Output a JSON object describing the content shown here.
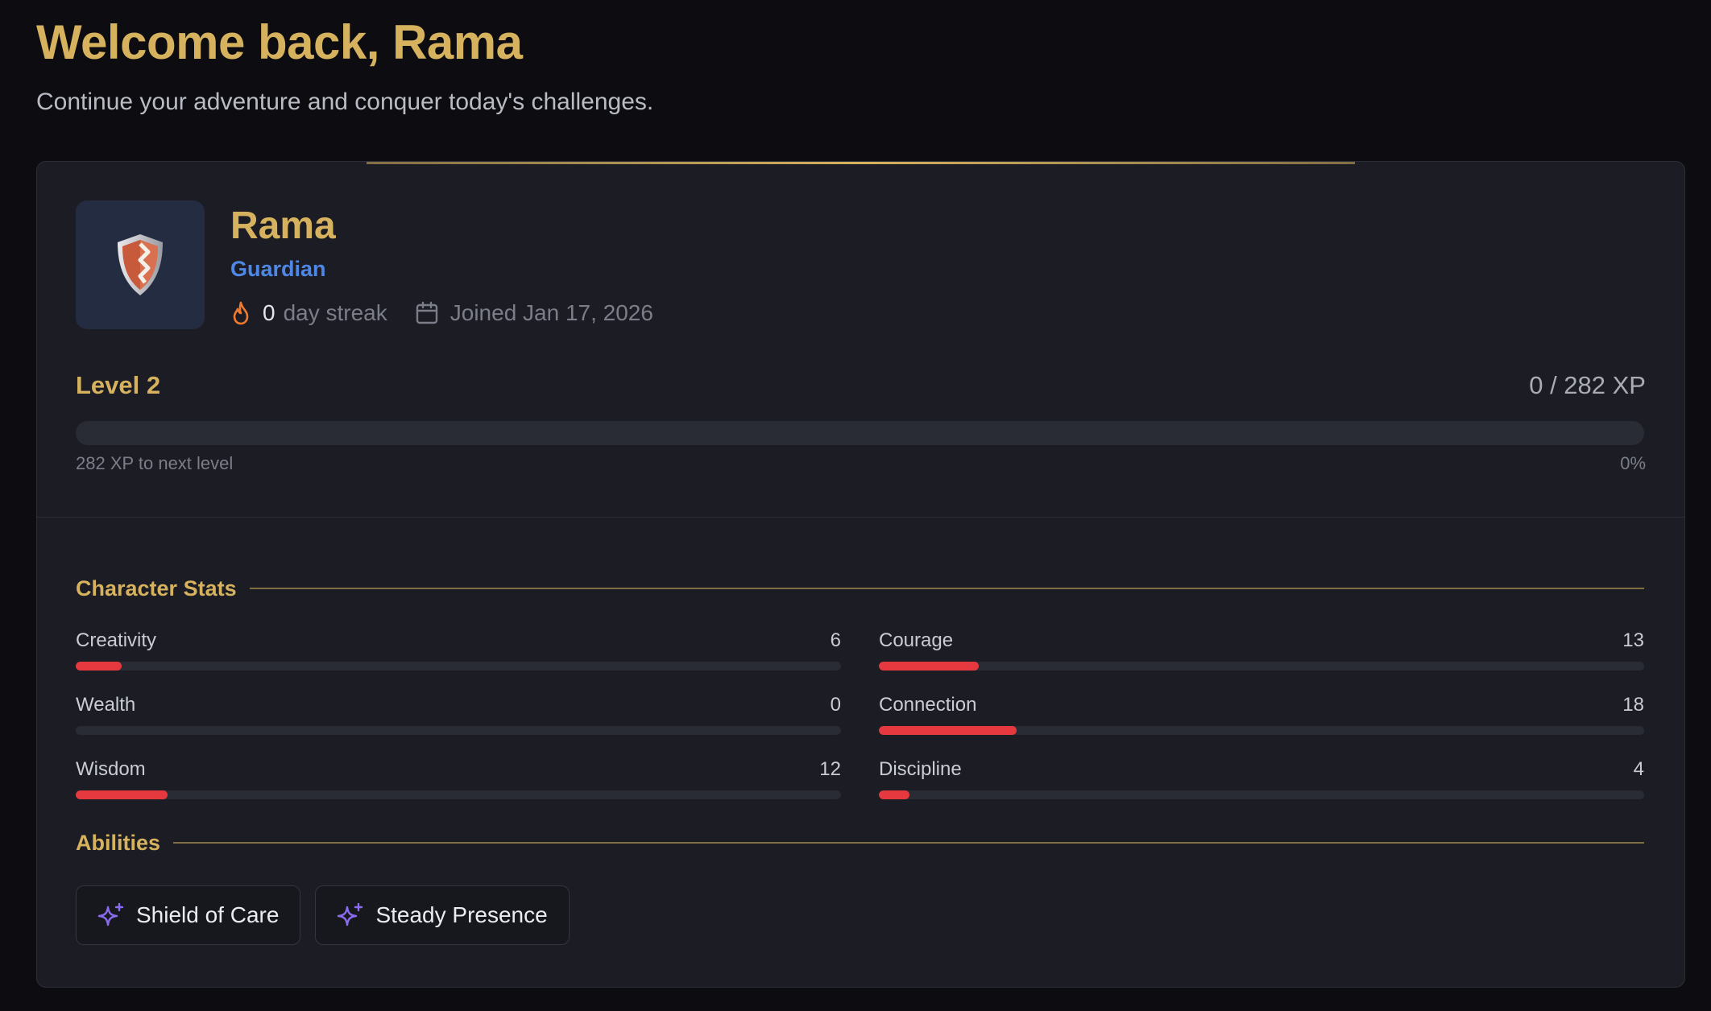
{
  "header": {
    "title": "Welcome back, Rama",
    "subtitle": "Continue your adventure and conquer today's challenges."
  },
  "profile": {
    "avatar_icon": "shield-icon",
    "name": "Rama",
    "class": "Guardian",
    "streak_count": "0",
    "streak_label": "day streak",
    "joined": "Joined Jan 17, 2026"
  },
  "level": {
    "label": "Level 2",
    "xp_total": "0 / 282 XP",
    "xp_progress_percent": 0,
    "next_label": "282 XP to next level",
    "percent_label": "0%"
  },
  "stats": {
    "heading": "Character Stats",
    "max_value": 100,
    "items": [
      {
        "name": "Creativity",
        "value": 6
      },
      {
        "name": "Courage",
        "value": 13
      },
      {
        "name": "Wealth",
        "value": 0
      },
      {
        "name": "Connection",
        "value": 18
      },
      {
        "name": "Wisdom",
        "value": 12
      },
      {
        "name": "Discipline",
        "value": 4
      }
    ]
  },
  "abilities": {
    "heading": "Abilities",
    "items": [
      {
        "label": "Shield of Care",
        "icon": "sparkles-icon"
      },
      {
        "label": "Steady Presence",
        "icon": "sparkles-icon"
      }
    ]
  },
  "colors": {
    "gold": "#d6b25e",
    "class_blue": "#4f87e6",
    "stat_bar": "#e5393f",
    "streak_flame": "#f07a2e",
    "ability_icon": "#8a6cf0"
  }
}
